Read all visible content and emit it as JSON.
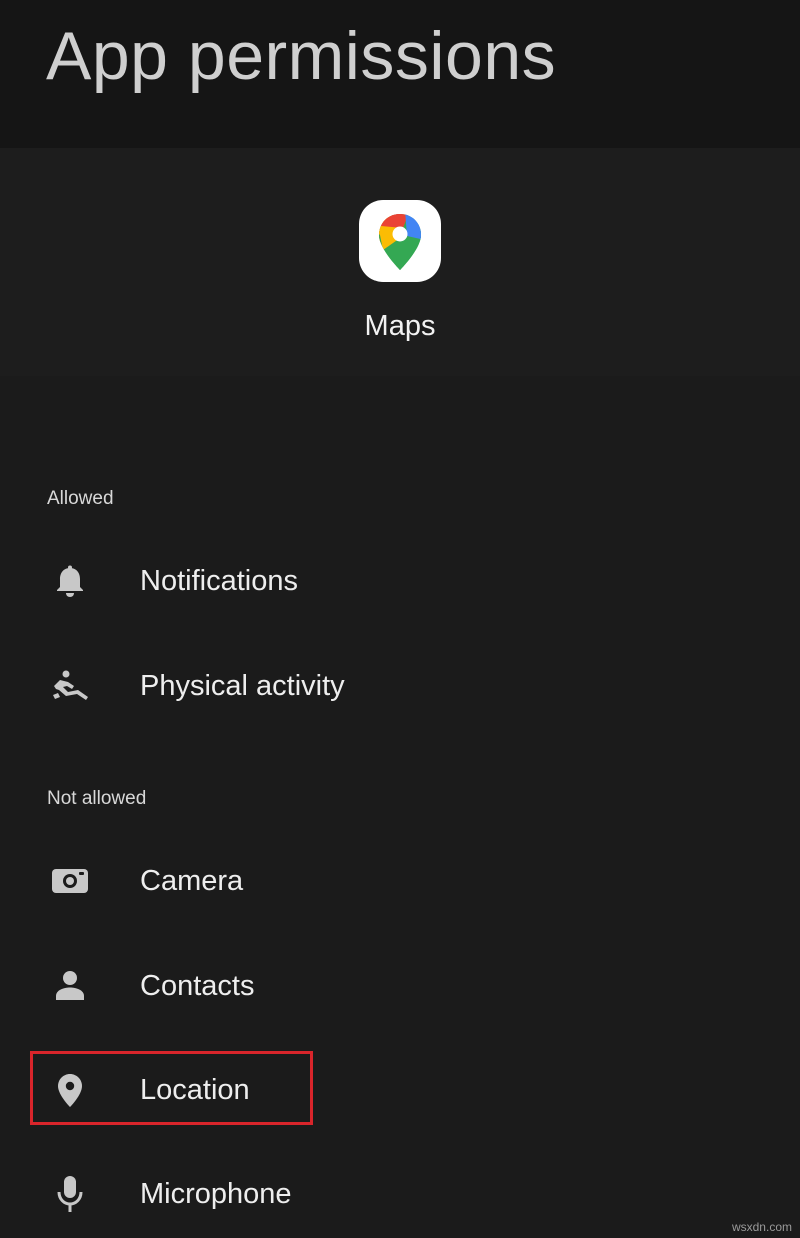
{
  "header": {
    "title": "App permissions"
  },
  "app": {
    "name": "Maps",
    "icon": "google-maps-icon"
  },
  "sections": {
    "allowed": {
      "label": "Allowed",
      "items": [
        {
          "label": "Notifications",
          "icon": "bell-icon"
        },
        {
          "label": "Physical activity",
          "icon": "physical-activity-icon"
        }
      ]
    },
    "not_allowed": {
      "label": "Not allowed",
      "items": [
        {
          "label": "Camera",
          "icon": "camera-icon"
        },
        {
          "label": "Contacts",
          "icon": "person-icon"
        },
        {
          "label": "Location",
          "icon": "location-pin-icon",
          "highlighted": true
        },
        {
          "label": "Microphone",
          "icon": "microphone-icon"
        }
      ]
    }
  },
  "colors": {
    "background": "#1b1b1b",
    "header_background": "#151515",
    "text": "#eeeeee",
    "icon": "#c8c8c8",
    "highlight": "#d9252b"
  },
  "watermark": "wsxdn.com"
}
